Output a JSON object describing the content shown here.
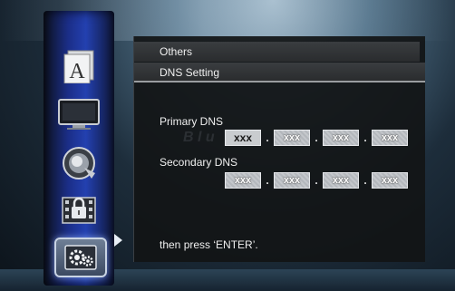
{
  "sidebar": {
    "items": [
      {
        "icon": "language-letter-icon"
      },
      {
        "icon": "display-monitor-icon"
      },
      {
        "icon": "audio-speaker-icon"
      },
      {
        "icon": "parental-lock-icon"
      },
      {
        "icon": "setup-gears-icon",
        "selected": true
      }
    ]
  },
  "panel": {
    "section_title": "Others",
    "page_title": "DNS Setting",
    "primary_label": "Primary DNS",
    "primary_fields": [
      "xxx",
      "xxx",
      "xxx",
      "xxx"
    ],
    "secondary_label": "Secondary DNS",
    "secondary_fields": [
      "xxx",
      "xxx",
      "xxx",
      "xxx"
    ],
    "separator": ".",
    "instruction": "then press ‘ENTER’."
  }
}
